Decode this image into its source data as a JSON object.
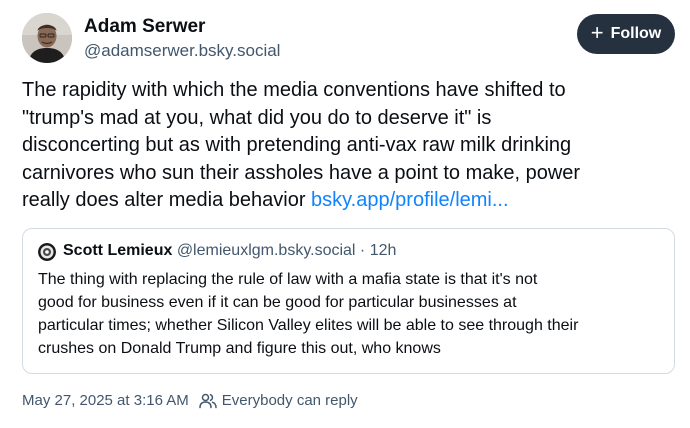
{
  "author": {
    "name": "Adam Serwer",
    "handle": "@adamserwer.bsky.social"
  },
  "follow_button": {
    "label": "Follow",
    "icon": "plus-icon"
  },
  "post": {
    "text_lines": [
      "The rapidity with which the media conventions have shifted to",
      "\"trump's mad at you, what did you do to deserve it\" is",
      "disconcerting but as with pretending anti-vax raw milk drinking",
      "carnivores who sun their assholes have a point to make, power",
      "really does alter media behavior "
    ],
    "link": "bsky.app/profile/lemi..."
  },
  "quote": {
    "name": "Scott Lemieux",
    "handle": "@lemieuxlgm.bsky.social",
    "separator": " · ",
    "time": "12h",
    "text_lines": [
      "The thing with replacing the rule of law with a mafia state is that it's not",
      "good for business even if it can be good for particular businesses at",
      "particular times; whether Silicon Valley elites will be able to see through their",
      "crushes on Donald Trump and figure this out, who knows"
    ]
  },
  "meta": {
    "timestamp": "May 27, 2025 at 3:16 AM",
    "reply_setting": "Everybody can reply",
    "reply_icon": "people-icon"
  },
  "colors": {
    "link": "#1083fe",
    "muted": "#42576c",
    "button_bg": "#263140",
    "border": "#d4dbe2"
  }
}
